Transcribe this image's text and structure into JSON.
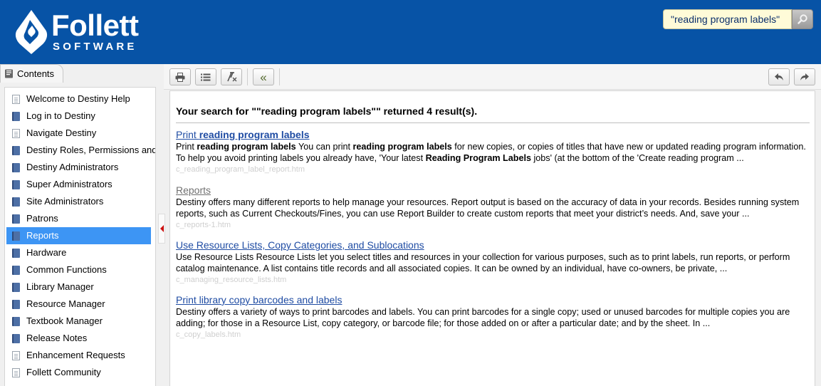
{
  "header": {
    "brand": {
      "name": "Follett",
      "sub": "SOFTWARE"
    },
    "search": {
      "value": "\"reading program labels\"",
      "button_icon": "search-icon"
    },
    "colors": {
      "header_bg": "#0753a6",
      "search_bg": "#fffbd8",
      "selected": "#3d95f4",
      "link": "#1f4ca3"
    }
  },
  "sidebar": {
    "tab_label": "Contents",
    "items": [
      {
        "label": "Welcome to Destiny Help",
        "icon": "page-icon"
      },
      {
        "label": "Log in to Destiny",
        "icon": "book-icon"
      },
      {
        "label": "Navigate Destiny",
        "icon": "page-icon"
      },
      {
        "label": "Destiny Roles, Permissions and Access",
        "icon": "book-icon"
      },
      {
        "label": "Destiny Administrators",
        "icon": "book-icon"
      },
      {
        "label": "Super Administrators",
        "icon": "book-icon"
      },
      {
        "label": "Site Administrators",
        "icon": "book-icon"
      },
      {
        "label": "Patrons",
        "icon": "book-icon"
      },
      {
        "label": "Reports",
        "icon": "book-icon",
        "selected": true
      },
      {
        "label": "Hardware",
        "icon": "book-icon"
      },
      {
        "label": "Common Functions",
        "icon": "book-icon"
      },
      {
        "label": "Library Manager",
        "icon": "book-icon"
      },
      {
        "label": "Resource Manager",
        "icon": "book-icon"
      },
      {
        "label": "Textbook Manager",
        "icon": "book-icon"
      },
      {
        "label": "Release Notes",
        "icon": "book-icon"
      },
      {
        "label": "Enhancement Requests",
        "icon": "page-icon"
      },
      {
        "label": "Follett Community",
        "icon": "page-icon"
      }
    ]
  },
  "toolbar": {
    "buttons": [
      {
        "name": "print-button",
        "icon": "printer-icon"
      },
      {
        "name": "toc-toggle-button",
        "icon": "list-icon"
      },
      {
        "name": "remove-highlight-button",
        "icon": "clear-format-icon"
      },
      {
        "name": "collapse-button",
        "icon": "double-chevron-left-icon",
        "glyph": "«"
      },
      {
        "name": "back-button",
        "icon": "back-arrow-icon"
      },
      {
        "name": "forward-button",
        "icon": "forward-arrow-icon"
      }
    ]
  },
  "main": {
    "summary": {
      "prefix": "Your search for \"",
      "query": "\"reading program labels\"",
      "suffix": "\" returned 4 result(s)."
    },
    "results": [
      {
        "title_parts": [
          {
            "text": "Print ",
            "bold": false
          },
          {
            "text": "reading program labels",
            "bold": true
          }
        ],
        "visited": false,
        "desc_lines": [
          [
            {
              "text": "Print ",
              "bold": false
            },
            {
              "text": "reading program labels",
              "bold": true
            },
            {
              "text": " You can print ",
              "bold": false
            },
            {
              "text": "reading program labels",
              "bold": true
            },
            {
              "text": " for new copies, or copies of titles that have new or updated reading program information.",
              "bold": false
            }
          ],
          [
            {
              "text": "To help you avoid printing labels you already have, 'Your latest ",
              "bold": false
            },
            {
              "text": "Reading Program Labels",
              "bold": true
            },
            {
              "text": " jobs' (at the bottom of the 'Create reading program ...",
              "bold": false
            }
          ]
        ],
        "file": "c_reading_program_label_report.htm"
      },
      {
        "title_parts": [
          {
            "text": "Reports",
            "bold": false
          }
        ],
        "visited": true,
        "desc_lines": [
          [
            {
              "text": "Destiny offers many different reports to help manage your resources. Report output is based on the accuracy of data in your records. Besides running system",
              "bold": false
            }
          ],
          [
            {
              "text": "reports, such as Current Checkouts/Fines, you can use Report Builder to create custom reports that meet your district’s needs. And, save your ...",
              "bold": false
            }
          ]
        ],
        "file": "c_reports-1.htm"
      },
      {
        "title_parts": [
          {
            "text": "Use Resource Lists, Copy Categories, and Sublocations",
            "bold": false
          }
        ],
        "visited": false,
        "desc_lines": [
          [
            {
              "text": "Use Resource Lists Resource Lists let you select titles and resources in your collection for various purposes, such as to print labels, run reports, or perform",
              "bold": false
            }
          ],
          [
            {
              "text": "catalog maintenance. A list contains title records and all associated copies. It can be owned by an individual, have co-owners, be private, ...",
              "bold": false
            }
          ]
        ],
        "file": "c_managing_resource_lists.htm"
      },
      {
        "title_parts": [
          {
            "text": "Print library copy barcodes and labels",
            "bold": false
          }
        ],
        "visited": false,
        "desc_lines": [
          [
            {
              "text": "Destiny offers a variety of ways to print barcodes and labels. You can print barcodes for a single copy; used or unused barcodes for multiple copies you are",
              "bold": false
            }
          ],
          [
            {
              "text": "adding; for those in a Resource List, copy category, or barcode file; for those added on or after a particular date; and by the sheet. In ...",
              "bold": false
            }
          ]
        ],
        "file": "c_copy_labels.htm"
      }
    ]
  }
}
